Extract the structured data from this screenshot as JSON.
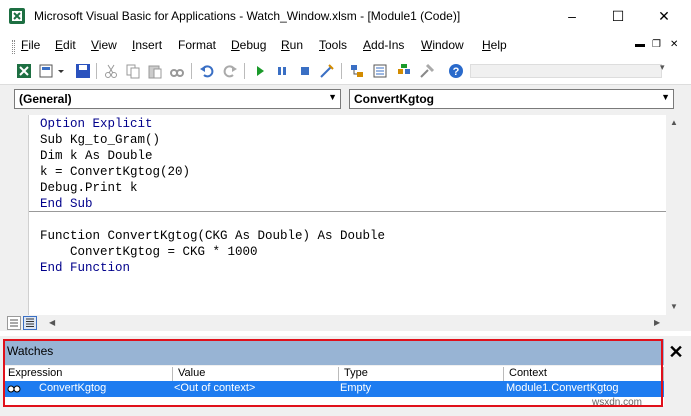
{
  "window": {
    "title": "Microsoft Visual Basic for Applications - Watch_Window.xlsm - [Module1 (Code)]",
    "minimize": "–",
    "maximize": "☐",
    "close": "✕"
  },
  "menu": {
    "items": [
      {
        "key": "F",
        "rest": "ile"
      },
      {
        "key": "E",
        "rest": "dit"
      },
      {
        "key": "V",
        "rest": "iew"
      },
      {
        "key": "I",
        "rest": "nsert"
      },
      {
        "key": "",
        "rest": "Format"
      },
      {
        "key": "D",
        "rest": "ebug"
      },
      {
        "key": "R",
        "rest": "un"
      },
      {
        "key": "T",
        "rest": "ools"
      },
      {
        "key": "A",
        "rest": "dd-Ins"
      },
      {
        "key": "W",
        "rest": "indow"
      },
      {
        "key": "H",
        "rest": "elp"
      }
    ],
    "mdi_minimize": "▬",
    "mdi_restore": "❐",
    "mdi_close": "✕"
  },
  "dropdowns": {
    "object": "(General)",
    "procedure": "ConvertKgtog"
  },
  "code": {
    "lines": [
      "Option Explicit",
      "Sub Kg_to_Gram()",
      "Dim k As Double",
      "k = ConvertKgtog(20)",
      "Debug.Print k",
      "End Sub",
      "Function ConvertKgtog(CKG As Double) As Double",
      "    ConvertKgtog = CKG * 1000",
      "End Function"
    ]
  },
  "watches": {
    "title": "Watches",
    "close": "✕",
    "columns": [
      "Expression",
      "Value",
      "Type",
      "Context"
    ],
    "rows": [
      {
        "expression": "ConvertKgtog",
        "value": "<Out of context>",
        "type": "Empty",
        "context": "Module1.ConvertKgtog"
      }
    ]
  },
  "watermark": "wsxdn.com",
  "colors": {
    "keyword": "#00008b",
    "watch_title_bg": "#98b4d4",
    "selected_row": "#1e7cf0",
    "highlight_box": "#e0101a"
  }
}
